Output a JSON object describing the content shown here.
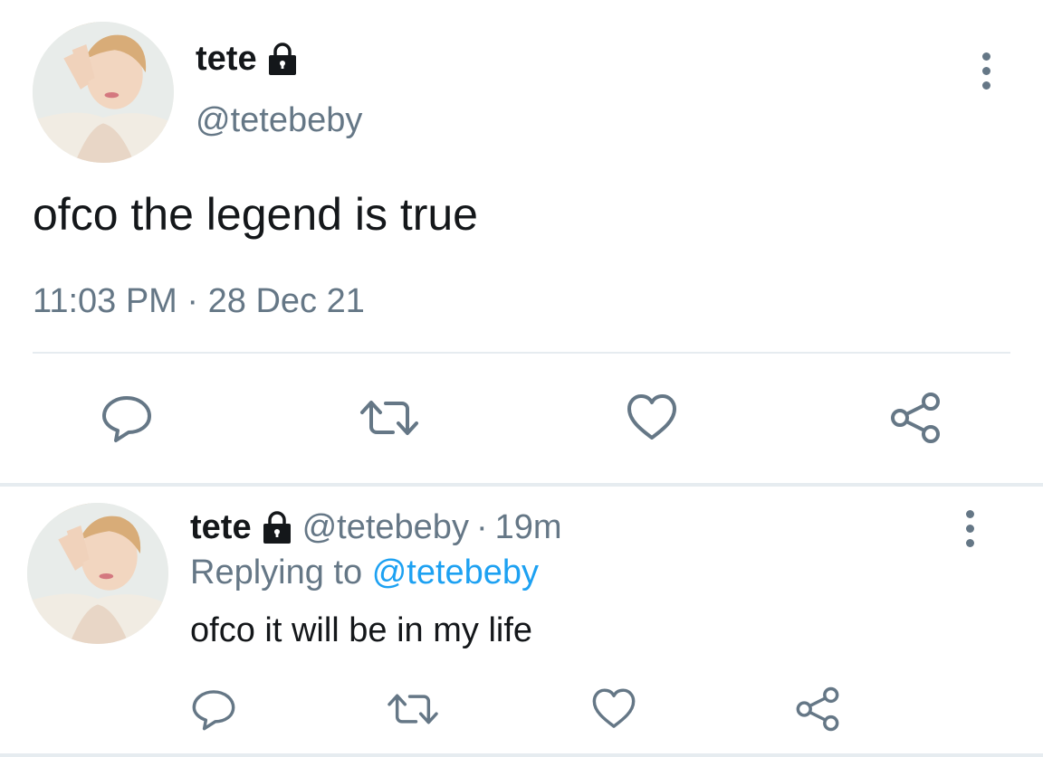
{
  "main_tweet": {
    "display_name": "tete",
    "handle": "@tetebeby",
    "text": "ofco the legend is true",
    "time": "11:03 PM",
    "date": "28 Dec 21",
    "meta_separator": " · ",
    "protected": true
  },
  "reply_tweet": {
    "display_name": "tete",
    "handle": "@tetebeby",
    "separator": "·",
    "age": "19m",
    "replying_prefix": "Replying to",
    "replying_to": "@tetebeby",
    "text": "ofco it will be in my life",
    "protected": true
  },
  "icons": {
    "lock": "lock-icon",
    "more": "more-vertical-icon",
    "reply": "reply-icon",
    "retweet": "retweet-icon",
    "like": "heart-icon",
    "share": "share-icon"
  },
  "colors": {
    "text_primary": "#14171a",
    "text_secondary": "#657786",
    "link": "#1da1f2",
    "divider": "#e6ecf0",
    "icon": "#657786"
  }
}
